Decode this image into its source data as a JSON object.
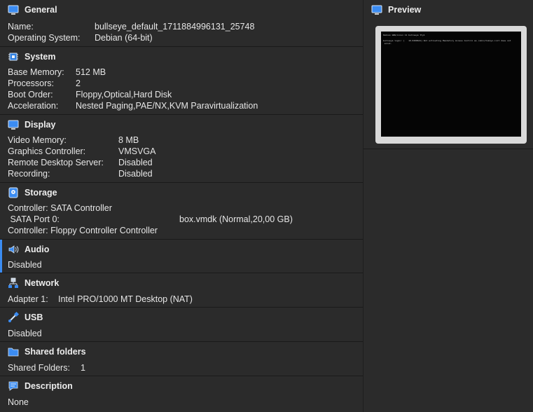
{
  "general": {
    "title": "General",
    "name_label": "Name:",
    "name_value": "bullseye_default_1711884996131_25748",
    "os_label": "Operating System:",
    "os_value": "Debian (64-bit)"
  },
  "system": {
    "title": "System",
    "mem_label": "Base Memory:",
    "mem_value": "512 MB",
    "proc_label": "Processors:",
    "proc_value": "2",
    "boot_label": "Boot Order:",
    "boot_value": "Floppy,Optical,Hard Disk",
    "accel_label": "Acceleration:",
    "accel_value": "Nested Paging,PAE/NX,KVM Paravirtualization"
  },
  "display": {
    "title": "Display",
    "vmem_label": "Video Memory:",
    "vmem_value": "8 MB",
    "gfx_label": "Graphics Controller:",
    "gfx_value": "VMSVGA",
    "rds_label": "Remote Desktop Server:",
    "rds_value": "Disabled",
    "rec_label": "Recording:",
    "rec_value": "Disabled"
  },
  "storage": {
    "title": "Storage",
    "ctrl1": "Controller: SATA Controller",
    "port_label": " SATA Port 0:",
    "port_value": "box.vmdk (Normal,20,00 GB)",
    "ctrl2": "Controller: Floppy Controller Controller"
  },
  "audio": {
    "title": "Audio",
    "value": "Disabled"
  },
  "network": {
    "title": "Network",
    "adapter_label": "Adapter 1:",
    "adapter_value": "Intel PRO/1000 MT Desktop (NAT)"
  },
  "usb": {
    "title": "USB",
    "value": "Disabled"
  },
  "shared": {
    "title": "Shared folders",
    "label": "Shared Folders:",
    "value": "1"
  },
  "description": {
    "title": "Description",
    "value": "None"
  },
  "preview": {
    "title": "Preview",
    "line1": "Debian GNU/Linux 11 bullseye tty1",
    "line2": "bullseye login: [   10.0498621] Not activating Mandatory Access Control as /sbin/tomoyo-init does not",
    "line3": " exist."
  },
  "colors": {
    "accent": "#3b8cf2",
    "panel": "#2b2b2b",
    "background": "#1e1e1e"
  }
}
